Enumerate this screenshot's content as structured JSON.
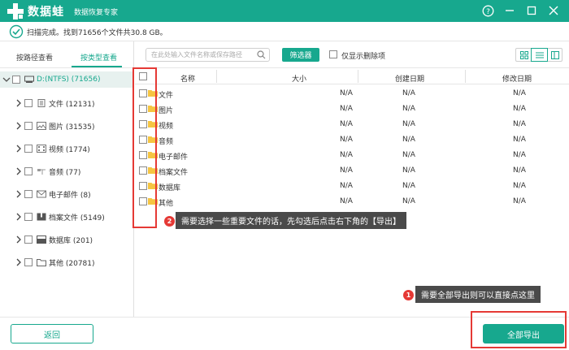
{
  "app": {
    "brand": "数据蛙",
    "subtitle": "数据恢复专家",
    "accent_color": "#17a88e"
  },
  "window_controls": [
    "help-icon",
    "minimize-icon",
    "restore-icon",
    "close-icon"
  ],
  "status": {
    "text": "扫描完成。找到71656个文件共30.8 GB。"
  },
  "tabs": [
    {
      "label": "按路径查看",
      "active": false
    },
    {
      "label": "按类型查看",
      "active": true
    }
  ],
  "tree": {
    "root": {
      "label": "D:(NTFS) (71656)",
      "icon": "drive-icon"
    },
    "items": [
      {
        "label": "文件 (12131)",
        "icon": "document-icon"
      },
      {
        "label": "图片 (31535)",
        "icon": "image-icon"
      },
      {
        "label": "视频 (1774)",
        "icon": "video-icon"
      },
      {
        "label": "音频 (77)",
        "icon": "audio-icon"
      },
      {
        "label": "电子邮件 (8)",
        "icon": "email-icon"
      },
      {
        "label": "档案文件 (5149)",
        "icon": "archive-icon"
      },
      {
        "label": "数据库 (201)",
        "icon": "database-icon"
      },
      {
        "label": "其他 (20781)",
        "icon": "folder-icon"
      }
    ]
  },
  "toolbar": {
    "search_placeholder": "在此处输入文件名称或保存路径",
    "filter_label": "筛选器",
    "only_deleted_label": "仅显示删除项"
  },
  "table": {
    "columns": [
      "名称",
      "大小",
      "创建日期",
      "修改日期"
    ],
    "rows": [
      {
        "name": "文件",
        "size": "N/A",
        "created": "N/A",
        "modified": "N/A"
      },
      {
        "name": "图片",
        "size": "N/A",
        "created": "N/A",
        "modified": "N/A"
      },
      {
        "name": "视频",
        "size": "N/A",
        "created": "N/A",
        "modified": "N/A"
      },
      {
        "name": "音频",
        "size": "N/A",
        "created": "N/A",
        "modified": "N/A"
      },
      {
        "name": "电子邮件",
        "size": "N/A",
        "created": "N/A",
        "modified": "N/A"
      },
      {
        "name": "档案文件",
        "size": "N/A",
        "created": "N/A",
        "modified": "N/A"
      },
      {
        "name": "数据库",
        "size": "N/A",
        "created": "N/A",
        "modified": "N/A"
      },
      {
        "name": "其他",
        "size": "N/A",
        "created": "N/A",
        "modified": "N/A"
      }
    ]
  },
  "annotations": {
    "tip2_number": "2",
    "tip2_text": "需要选择一些重要文件的话，先勾选后点击右下角的【导出】",
    "tip1_number": "1",
    "tip1_text": "需要全部导出则可以直接点这里"
  },
  "bottom": {
    "back_label": "返回",
    "export_all_label": "全部导出"
  }
}
